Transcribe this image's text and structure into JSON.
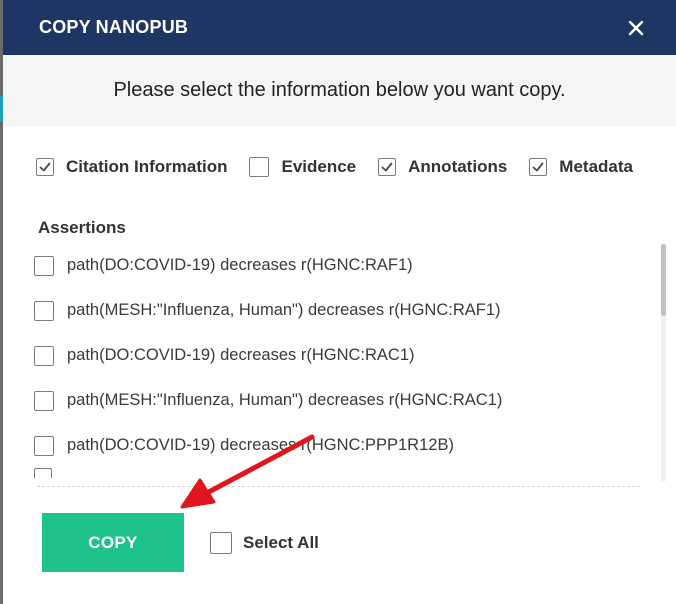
{
  "modal": {
    "title": "COPY NANOPUB",
    "close_icon": "close-icon",
    "instruction": "Please select the information below you want copy."
  },
  "options": [
    {
      "label": "Citation Information",
      "checked": true
    },
    {
      "label": "Evidence",
      "checked": false
    },
    {
      "label": "Annotations",
      "checked": true
    },
    {
      "label": "Metadata",
      "checked": true
    }
  ],
  "assertions": {
    "heading": "Assertions",
    "items": [
      {
        "text": "path(DO:COVID-19) decreases r(HGNC:RAF1)",
        "checked": false
      },
      {
        "text": "path(MESH:\"Influenza, Human\") decreases r(HGNC:RAF1)",
        "checked": false
      },
      {
        "text": "path(DO:COVID-19) decreases r(HGNC:RAC1)",
        "checked": false
      },
      {
        "text": "path(MESH:\"Influenza, Human\") decreases r(HGNC:RAC1)",
        "checked": false
      },
      {
        "text": "path(DO:COVID-19) decreases r(HGNC:PPP1R12B)",
        "checked": false
      }
    ]
  },
  "footer": {
    "copy_label": "COPY",
    "select_all_label": "Select All",
    "select_all_checked": false
  },
  "colors": {
    "header_bg": "#1f3563",
    "copy_button": "#1fc389",
    "annotation_arrow": "#e0161e"
  }
}
